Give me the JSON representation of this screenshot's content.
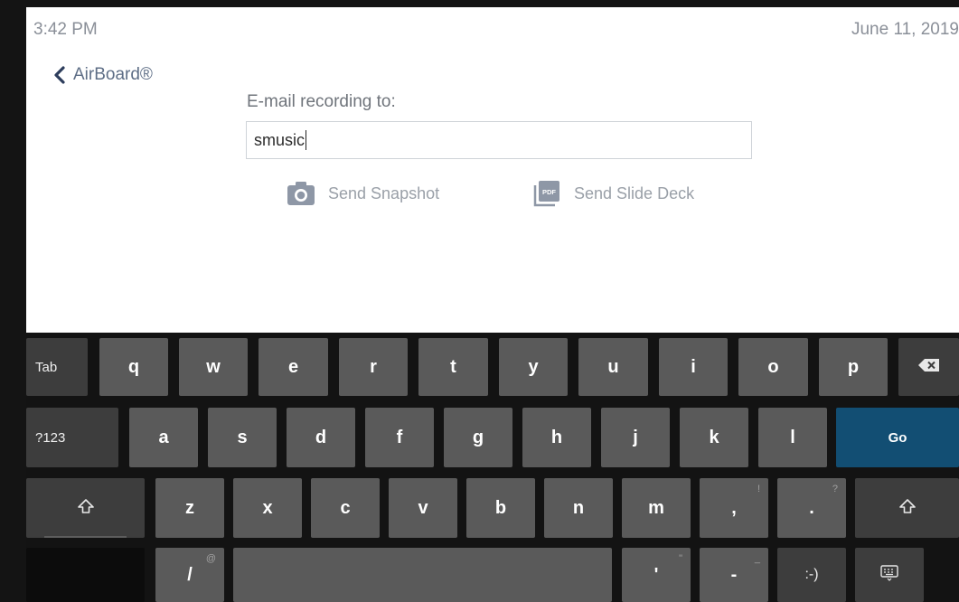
{
  "status": {
    "time": "3:42 PM",
    "date": "June 11, 2019"
  },
  "header": {
    "back_label": "AirBoard®"
  },
  "email": {
    "label": "E-mail recording to:",
    "value": "smusic"
  },
  "actions": {
    "snapshot_label": "Send Snapshot",
    "deck_label": "Send Slide Deck",
    "pdf_badge": "PDF"
  },
  "colors": {
    "go_key": "#124e73",
    "letter_key": "#5a5a5a",
    "keyboard_bg": "#131313",
    "muted_text": "#9aa0a8"
  },
  "keyboard": {
    "row1": [
      "q",
      "w",
      "e",
      "r",
      "t",
      "y",
      "u",
      "i",
      "o",
      "p"
    ],
    "row2": [
      "a",
      "s",
      "d",
      "f",
      "g",
      "h",
      "j",
      "k",
      "l"
    ],
    "row3": [
      "z",
      "x",
      "c",
      "v",
      "b",
      "n",
      "m",
      ",",
      "."
    ],
    "row4": [
      "/",
      "'",
      "-",
      ":-)"
    ],
    "tab_label": "Tab",
    "symbols_label": "?123",
    "go_label": "Go",
    "hints": {
      "at": "@",
      "exclaim": "!",
      "question": "?",
      "dquote": "\"",
      "underscore": "_"
    },
    "icons": [
      "backspace-icon",
      "shift-icon",
      "keyboard-icon"
    ]
  }
}
